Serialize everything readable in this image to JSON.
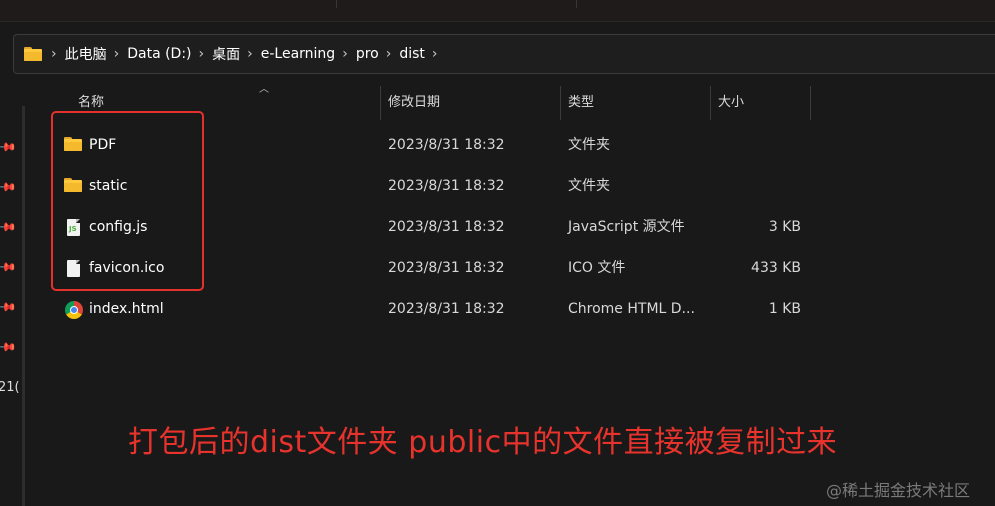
{
  "breadcrumb": {
    "icon": "folder-icon",
    "items": [
      "此电脑",
      "Data (D:)",
      "桌面",
      "e-Learning",
      "pro",
      "dist"
    ],
    "separator": "›"
  },
  "columns": {
    "name": "名称",
    "date": "修改日期",
    "type": "类型",
    "size": "大小"
  },
  "files": [
    {
      "name": "PDF",
      "date": "2023/8/31 18:32",
      "type": "文件夹",
      "size": "",
      "icon": "folder-icon"
    },
    {
      "name": "static",
      "date": "2023/8/31 18:32",
      "type": "文件夹",
      "size": "",
      "icon": "folder-icon"
    },
    {
      "name": "config.js",
      "date": "2023/8/31 18:32",
      "type": "JavaScript 源文件",
      "size": "3 KB",
      "icon": "js-file-icon"
    },
    {
      "name": "favicon.ico",
      "date": "2023/8/31 18:32",
      "type": "ICO 文件",
      "size": "433 KB",
      "icon": "file-icon"
    },
    {
      "name": "index.html",
      "date": "2023/8/31 18:32",
      "type": "Chrome HTML D...",
      "size": "1 KB",
      "icon": "chrome-icon"
    }
  ],
  "navpane": {
    "partial_text": "21("
  },
  "annotation": "打包后的dist文件夹  public中的文件直接被复制过来",
  "watermark": "@稀土掘金技术社区",
  "colors": {
    "background": "#191919",
    "annotation_red": "#e5312c",
    "folder_yellow": "#ffc83d"
  }
}
